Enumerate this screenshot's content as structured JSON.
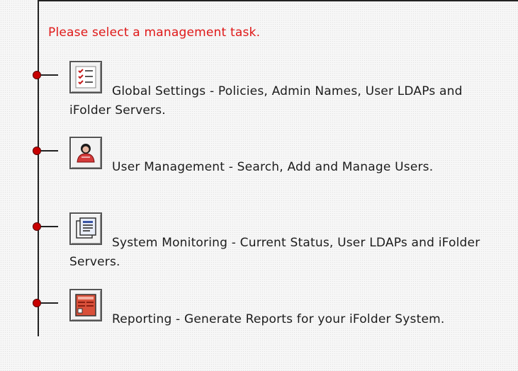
{
  "intro": {
    "text": "Please select a management task."
  },
  "tasks": [
    {
      "icon": "checklist-icon",
      "label": "Global Settings - Policies, Admin Names, User LDAPs and iFolder Servers."
    },
    {
      "icon": "user-icon",
      "label": "User Management - Search, Add and Manage Users."
    },
    {
      "icon": "monitoring-icon",
      "label": "System Monitoring - Current Status, User LDAPs and iFolder Servers."
    },
    {
      "icon": "report-icon",
      "label": "Reporting - Generate Reports for your iFolder System."
    }
  ],
  "colors": {
    "intro_text": "#e01818",
    "node": "#c80000",
    "timeline": "#222222"
  }
}
